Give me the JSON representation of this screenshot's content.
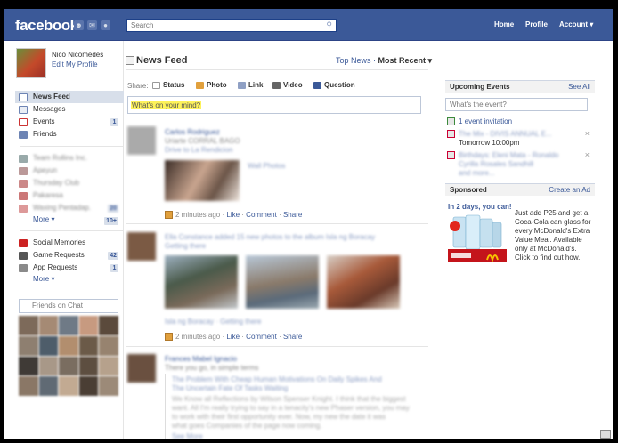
{
  "topbar": {
    "logo": "facebook",
    "search_placeholder": "Search",
    "nav": [
      "Home",
      "Profile",
      "Account ▾"
    ]
  },
  "profile": {
    "name": "Nico Nicomedes",
    "edit_link": "Edit My Profile"
  },
  "sidebar": {
    "items": [
      {
        "label": "News Feed",
        "active": true,
        "icon": "news-feed-icon",
        "count": ""
      },
      {
        "label": "Messages",
        "active": false,
        "icon": "messages-icon",
        "count": ""
      },
      {
        "label": "Events",
        "active": false,
        "icon": "events-icon",
        "count": "1"
      },
      {
        "label": "Friends",
        "active": false,
        "icon": "friends-icon",
        "count": ""
      }
    ],
    "more_groups": "More ▾",
    "more_groups_badge": "10+",
    "apps": [
      {
        "label": "Social Memories",
        "icon": "social-memories-icon",
        "count": ""
      },
      {
        "label": "Game Requests",
        "icon": "game-requests-icon",
        "count": "42"
      },
      {
        "label": "App Requests",
        "icon": "app-requests-icon",
        "count": "1"
      }
    ],
    "more_apps": "More ▾",
    "friends_on_chat": "Friends on Chat"
  },
  "feed": {
    "title": "News Feed",
    "sort_top": "Top News",
    "sort_sep": " · ",
    "sort_recent": "Most Recent ▾",
    "share_label": "Share:",
    "share_options": [
      "Status",
      "Photo",
      "Link",
      "Video",
      "Question"
    ],
    "composer_placeholder": "What's on your mind?",
    "stories": [
      {
        "time": "2 minutes ago",
        "actions": [
          "Like",
          "Comment",
          "Share"
        ]
      },
      {
        "time": "2 minutes ago",
        "actions": [
          "Like",
          "Comment",
          "Share"
        ]
      }
    ]
  },
  "right": {
    "events_title": "Upcoming Events",
    "see_all": "See All",
    "event_placeholder": "What's the event?",
    "invitation": "1 event invitation",
    "event_time": "Tomorrow 10:00pm",
    "sponsored_title": "Sponsored",
    "create_ad": "Create an Ad",
    "ad_headline": "In 2 days, you can!",
    "ad_text": "Just add P25 and get a Coca-Cola can glass for every McDonald's Extra Value Meal. Available only at McDonald's. Click to find out how."
  },
  "colors": {
    "brand": "#3b5998",
    "highlight": "#fdf25b"
  }
}
